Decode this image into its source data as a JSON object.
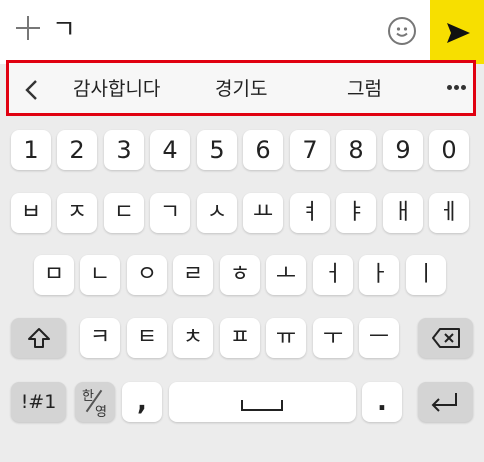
{
  "input": {
    "typed_text": "ㄱ"
  },
  "icons": {
    "add": "plus-icon",
    "emoji": "emoji-icon",
    "send": "send-icon",
    "suggestion_back": "chevron-left-icon",
    "suggestion_more": "more-horizontal-icon",
    "shift": "shift-icon",
    "backspace": "backspace-icon",
    "space": "space-icon",
    "enter": "enter-icon"
  },
  "colors": {
    "send_bg": "#f7df00",
    "highlight_border": "#e00010"
  },
  "suggestions": [
    "감사합니다",
    "경기도",
    "그럼"
  ],
  "keyboard": {
    "row_numbers": [
      "1",
      "2",
      "3",
      "4",
      "5",
      "6",
      "7",
      "8",
      "9",
      "0"
    ],
    "row_consonants_top": [
      "ㅂ",
      "ㅈ",
      "ㄷ",
      "ㄱ",
      "ㅅ",
      "ㅛ",
      "ㅕ",
      "ㅑ",
      "ㅐ",
      "ㅔ"
    ],
    "row_middle": [
      "ㅁ",
      "ㄴ",
      "ㅇ",
      "ㄹ",
      "ㅎ",
      "ㅗ",
      "ㅓ",
      "ㅏ",
      "ㅣ"
    ],
    "row_bottom": [
      "ㅋ",
      "ㅌ",
      "ㅊ",
      "ㅍ",
      "ㅠ",
      "ㅜ",
      "ㅡ"
    ],
    "symbol_key": "!#1",
    "lang_key_han": "한",
    "lang_key_yeong": "영",
    "comma": ",",
    "period": "."
  }
}
